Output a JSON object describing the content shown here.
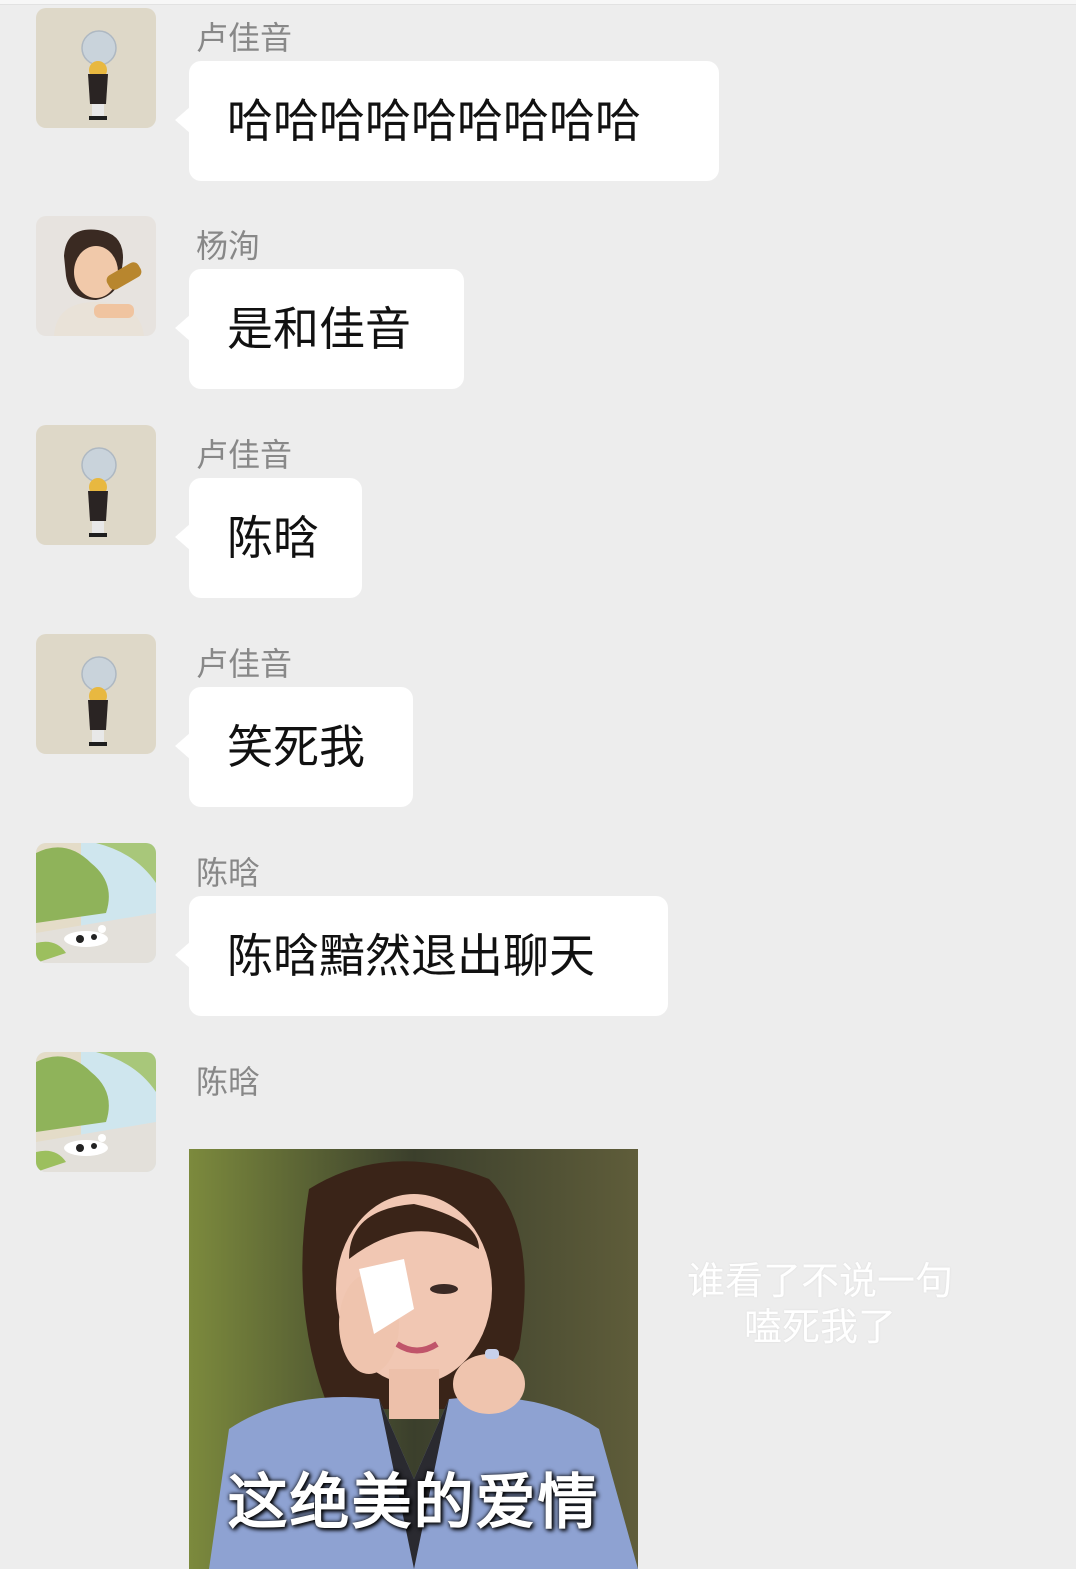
{
  "messages": [
    {
      "sender": "卢佳音",
      "avatar": "girl-with-balloon-avatar",
      "text": "哈哈哈哈哈哈哈哈哈"
    },
    {
      "sender": "杨洵",
      "avatar": "child-eating-avatar",
      "text": "是和佳音"
    },
    {
      "sender": "卢佳音",
      "avatar": "girl-with-balloon-avatar",
      "text": "陈晗"
    },
    {
      "sender": "卢佳音",
      "avatar": "girl-with-balloon-avatar",
      "text": "笑死我"
    },
    {
      "sender": "陈晗",
      "avatar": "illustrated-cat-garden-avatar",
      "text": "陈晗黯然退出聊天"
    },
    {
      "sender": "陈晗",
      "avatar": "illustrated-cat-garden-avatar",
      "sticker": {
        "caption": "这绝美的爱情",
        "description_icon": "crying-woman-sticker"
      }
    }
  ],
  "watermark": {
    "line1": "谁看了不说一句",
    "line2": "嗑死我了"
  },
  "colors": {
    "background": "#ededed",
    "bubble": "#ffffff",
    "sender_name": "#888888"
  }
}
